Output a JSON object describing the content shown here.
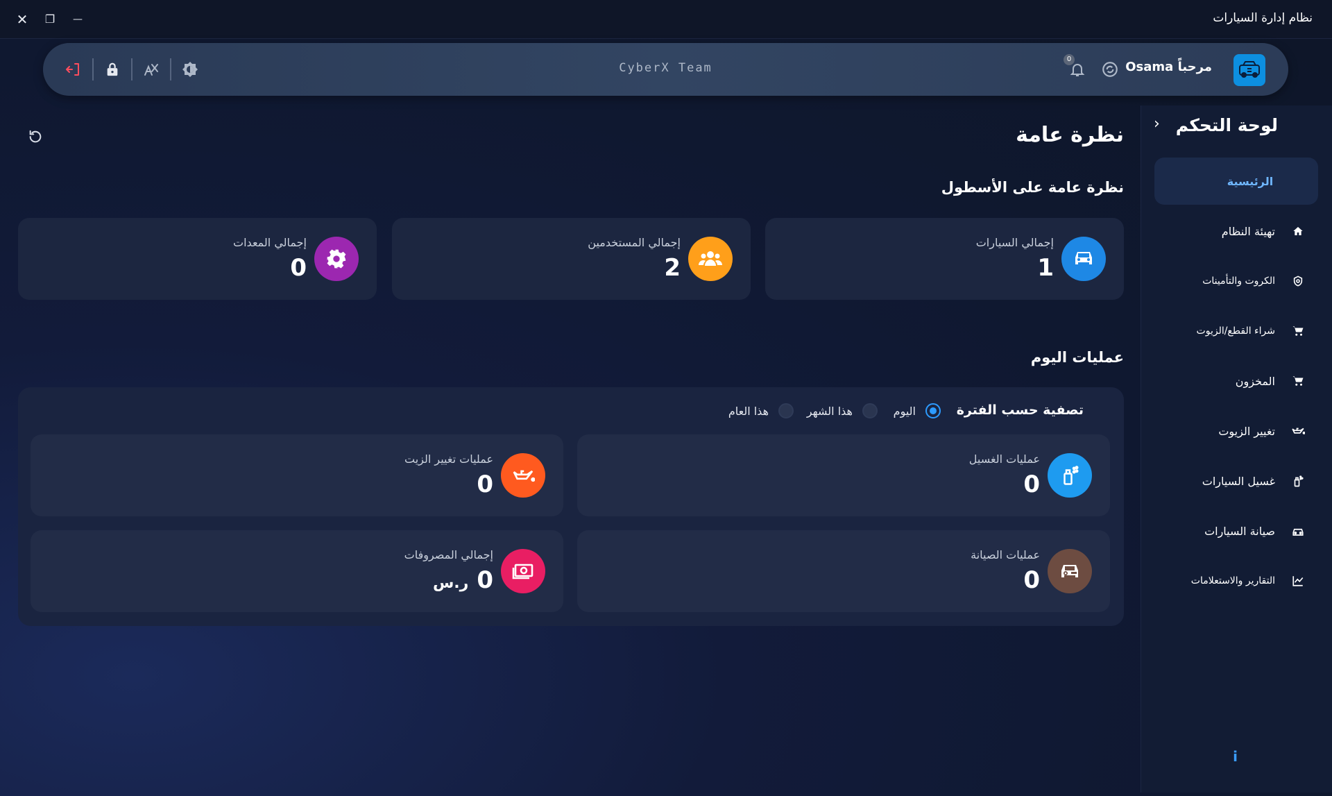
{
  "window": {
    "title": "نظام إدارة السيارات",
    "close_glyph": "✕",
    "restore_glyph": "❐",
    "minimize_glyph": "—"
  },
  "header": {
    "team_name": "CyberX Team",
    "greeting": "مرحباً Osama",
    "notification_count": "0",
    "icons": [
      "logout-icon",
      "lock-icon",
      "translate-icon",
      "theme-icon",
      "bell-icon",
      "sync-icon",
      "car-logo-icon"
    ]
  },
  "sidebar": {
    "title": "لوحة التحكم",
    "collapse_glyph": "›",
    "home_label": "الرئيسية",
    "items": [
      {
        "label": "تهيئة النظام",
        "icon": "home-icon"
      },
      {
        "label": "الكروت والتأمينات",
        "icon": "shield-icon"
      },
      {
        "label": "شراء القطع/الزيوت",
        "icon": "cart-icon"
      },
      {
        "label": "المخزون",
        "icon": "cart-icon"
      },
      {
        "label": "تغيير الزيوت",
        "icon": "oil-can-icon"
      },
      {
        "label": "غسيل السيارات",
        "icon": "spray-icon"
      },
      {
        "label": "صيانة السيارات",
        "icon": "car-repair-icon"
      },
      {
        "label": "التقارير والاستعلامات",
        "icon": "chart-icon"
      }
    ],
    "info_glyph": "i"
  },
  "main": {
    "page_title": "نظرة عامة",
    "fleet_section_title": "نظرة عامة على الأسطول",
    "fleet_stats": [
      {
        "label": "إجمالي السيارات",
        "value": "1",
        "color": "#1e88e5",
        "icon": "car-icon"
      },
      {
        "label": "إجمالي المستخدمين",
        "value": "2",
        "color": "#ff9f1a",
        "icon": "users-icon"
      },
      {
        "label": "إجمالي المعدات",
        "value": "0",
        "color": "#9c27b0",
        "icon": "gear-icon"
      }
    ],
    "ops_section_title": "عمليات اليوم",
    "filter": {
      "title": "تصفية حسب الفترة",
      "options": [
        "اليوم",
        "هذا الشهر",
        "هذا العام"
      ],
      "selected": "اليوم"
    },
    "ops_stats": [
      {
        "label": "عمليات الغسيل",
        "value": "0",
        "color": "#1e9bf0",
        "icon": "spray-icon"
      },
      {
        "label": "عمليات تغيير الزيت",
        "value": "0",
        "color": "#ff5a1f",
        "icon": "oil-can-icon"
      },
      {
        "label": "عمليات الصيانة",
        "value": "0",
        "color": "#6d4c41",
        "icon": "car-repair-icon"
      },
      {
        "label": "إجمالي المصروفات",
        "value": "0",
        "unit": "ر.س",
        "color": "#e91e63",
        "icon": "money-icon"
      }
    ]
  }
}
